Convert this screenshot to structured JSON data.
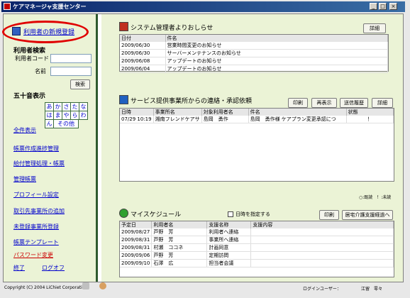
{
  "window": {
    "title": "ケアマネージャ支援センター",
    "min": "_",
    "max": "□",
    "close": "×"
  },
  "sidebar": {
    "new_registration": "利用者の新規登録",
    "user_search": {
      "title": "利用者検索",
      "code_label": "利用者コード",
      "name_label": "名前",
      "search_button": "検索"
    },
    "kana_index": {
      "title": "五十音表示",
      "row1": [
        "あ",
        "か",
        "さ",
        "た",
        "な"
      ],
      "row2": [
        "は",
        "ま",
        "や",
        "ら",
        "わ"
      ],
      "n": "ん",
      "other": "その他"
    },
    "show_all": "全件表示",
    "links": [
      "帳票作成進捗管理",
      "給付管理処理・帳票",
      "管理帳票",
      "プロフィール設定",
      "取引先事業所の追加",
      "未登録事業所登録",
      "帳票テンプレート",
      "パスワード変更"
    ],
    "end": "終了",
    "logoff": "ログオフ"
  },
  "notices": {
    "title": "システム管理者よりおしらせ",
    "detail_button": "詳細",
    "columns": [
      "日付",
      "件名"
    ],
    "rows": [
      [
        "2009/06/30",
        "営業時間変更のお知らせ"
      ],
      [
        "2009/06/30",
        "サーバーメンテナンスのお知らせ"
      ],
      [
        "2009/06/08",
        "アップデートのお知らせ"
      ],
      [
        "2009/06/04",
        "アップデートのお知らせ"
      ]
    ]
  },
  "service": {
    "title": "サービス提供事業所からの連絡・承認依頼",
    "buttons": [
      "印刷",
      "再表示",
      "送信履歴",
      "詳細"
    ],
    "columns": [
      "日時",
      "事業所名",
      "対象利用者名",
      "件名",
      "状態"
    ],
    "rows": [
      [
        "07/29 10:19",
        "湘南フレンドケアサ",
        "島岡　勇作",
        "島岡　勇作様 ケアプラン変更承認につ",
        "！"
      ]
    ],
    "legend": "○:既読　！:未読"
  },
  "schedule": {
    "title": "マイスケジュール",
    "date_option": "日時を指定する",
    "buttons": [
      "印刷",
      "居宅介護支援経過へ"
    ],
    "columns": [
      "予定日",
      "利用者名",
      "支援名称",
      "支援内容"
    ],
    "rows": [
      [
        "2009/08/27",
        "芦野　芳",
        "利用者へ連絡",
        ""
      ],
      [
        "2009/08/31",
        "芦野　芳",
        "事業所へ連絡",
        ""
      ],
      [
        "2009/08/31",
        "村瀬　ココネ",
        "計画同意",
        ""
      ],
      [
        "2009/09/06",
        "芦野　芳",
        "定期訪問",
        ""
      ],
      [
        "2009/09/10",
        "石澤　広",
        "担当者会議",
        ""
      ]
    ]
  },
  "footer": {
    "copyright": "Copyright (C) 2004 LiChiet Corporation",
    "login_label": "ログインユーザー：",
    "login_user": "江留　零々"
  },
  "colors": {
    "sidebar_bg": "#ebf3d6",
    "accent_dark_green": "#2e5b2e",
    "link_blue": "#0000cc",
    "highlight_red": "#e00000"
  }
}
